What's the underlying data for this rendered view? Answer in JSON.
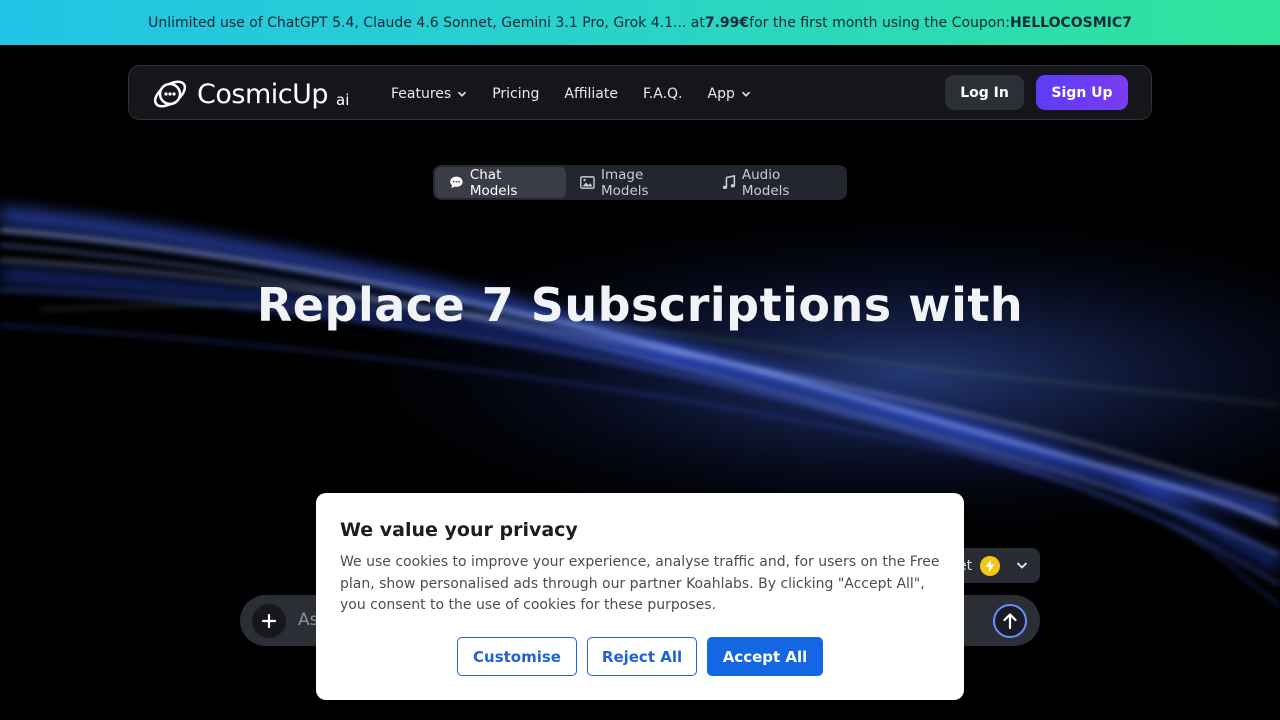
{
  "promo": {
    "text_before": "Unlimited use of ChatGPT 5.4, Claude 4.6 Sonnet, Gemini 3.1 Pro, Grok 4.1... at ",
    "price": "7.99€",
    "text_middle": " for the first month using the Coupon: ",
    "coupon": "HELLOCOSMIC7",
    "colors": {
      "start": "#22c3e6",
      "end": "#2ee59a"
    }
  },
  "nav": {
    "logo_text": "CosmicUp",
    "logo_suffix": "ai",
    "items": [
      {
        "label": "Features",
        "has_dropdown": true
      },
      {
        "label": "Pricing",
        "has_dropdown": false
      },
      {
        "label": "Affiliate",
        "has_dropdown": false
      },
      {
        "label": "F.A.Q.",
        "has_dropdown": false
      },
      {
        "label": "App",
        "has_dropdown": true
      }
    ],
    "login_label": "Log In",
    "signup_label": "Sign Up",
    "accent_color": "#5b3df5"
  },
  "tabs": [
    {
      "label": "Chat Models",
      "icon": "chat-bubble-icon",
      "active": true
    },
    {
      "label": "Image Models",
      "icon": "image-icon",
      "active": false
    },
    {
      "label": "Audio Models",
      "icon": "music-note-icon",
      "active": false
    }
  ],
  "hero": {
    "title": "Replace 7 Subscriptions with"
  },
  "model_selector": {
    "partial_label": "et",
    "icon": "lightning-bolt-icon"
  },
  "prompt": {
    "placeholder": "As"
  },
  "cookie_modal": {
    "title": "We value your privacy",
    "text": "We use cookies to improve your experience, analyse traffic and, for users on the Free plan, show personalised ads through our partner Koahlabs. By clicking \"Accept All\", you consent to the use of cookies for these purposes.",
    "customise_label": "Customise",
    "reject_label": "Reject All",
    "accept_label": "Accept All",
    "accent_color": "#1466e3"
  }
}
